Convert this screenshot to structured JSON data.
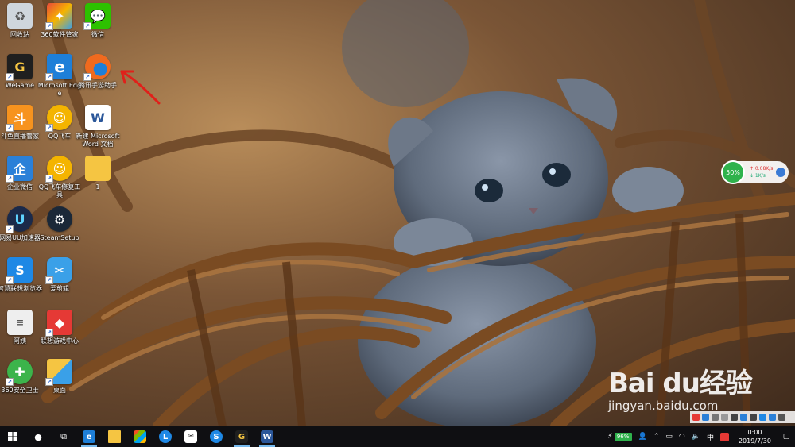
{
  "desktop": {
    "icons": [
      {
        "label": "回收站",
        "icon": "recycle-bin-icon",
        "color": "#cfd6dd"
      },
      {
        "label": "360软件管家",
        "icon": "360-software-icon",
        "color": "#e8473a"
      },
      {
        "label": "微信",
        "icon": "wechat-icon",
        "color": "#2dc100"
      },
      {
        "label": "WeGame",
        "icon": "wegame-icon",
        "color": "#1f1f1f"
      },
      {
        "label": "Microsoft Edge",
        "icon": "edge-icon",
        "color": "#1e7fd8"
      },
      {
        "label": "腾讯手游助手",
        "icon": "tencent-mobile-game-icon",
        "color": "#f06a1e"
      },
      {
        "label": "斗鱼直播管家",
        "icon": "douyu-icon",
        "color": "#f7931e"
      },
      {
        "label": "QQ飞车",
        "icon": "qq-speed-icon",
        "color": "#f4b400"
      },
      {
        "label": "新建 Microsoft Word 文档",
        "icon": "word-doc-icon",
        "color": "#2b579a"
      },
      {
        "label": "企业微信",
        "icon": "wecom-icon",
        "color": "#2a80d8"
      },
      {
        "label": "QQ飞车修复工具",
        "icon": "qq-speed-repair-icon",
        "color": "#f4b400"
      },
      {
        "label": "1",
        "icon": "folder-icon",
        "color": "#f5c542"
      },
      {
        "label": "网易UU加速器",
        "icon": "uu-accelerator-icon",
        "color": "#1b2a4a"
      },
      {
        "label": "SteamSetup",
        "icon": "steam-icon",
        "color": "#1b2838"
      },
      {
        "label": "智慧联想浏览器",
        "icon": "lenovo-browser-icon",
        "color": "#1e88e5"
      },
      {
        "label": "爱剪辑",
        "icon": "aijianji-icon",
        "color": "#3aa0e8"
      },
      {
        "label": "阿姨",
        "icon": "text-file-icon",
        "color": "#eeeeee"
      },
      {
        "label": "联想游戏中心",
        "icon": "lenovo-game-center-icon",
        "color": "#e53935"
      },
      {
        "label": "360安全卫士",
        "icon": "360-safe-icon",
        "color": "#3cb44b"
      },
      {
        "label": "桌面",
        "icon": "desktop-shortcut-icon",
        "color": "#f5c542"
      }
    ]
  },
  "net_widget": {
    "percent": "50%",
    "upload": "↑ 0.08K/s",
    "download": "↓ 1K/s"
  },
  "watermark": {
    "brand": "Bai du经验",
    "url": "jingyan.baidu.com"
  },
  "taskbar": {
    "apps": [
      {
        "name": "edge",
        "icon": "edge-icon",
        "glyph": "e",
        "color": "#1e7fd8"
      },
      {
        "name": "explorer",
        "icon": "file-explorer-icon",
        "glyph": "",
        "color": "#f5c542"
      },
      {
        "name": "store",
        "icon": "store-icon",
        "glyph": "",
        "color": "#ffffff"
      },
      {
        "name": "clock-app",
        "icon": "clock-app-icon",
        "glyph": "",
        "color": "#1e88e5"
      },
      {
        "name": "mail",
        "icon": "mail-icon",
        "glyph": "",
        "color": "#ffffff"
      },
      {
        "name": "lenovo-browser",
        "icon": "lenovo-browser-icon",
        "glyph": "",
        "color": "#1e88e5"
      },
      {
        "name": "wegame",
        "icon": "wegame-icon",
        "glyph": "G",
        "color": "#1f1f1f"
      },
      {
        "name": "word",
        "icon": "word-icon",
        "glyph": "W",
        "color": "#2b579a"
      }
    ],
    "battery": "96%",
    "ime": "中",
    "time": "0:00",
    "date": "2019/7/30"
  }
}
